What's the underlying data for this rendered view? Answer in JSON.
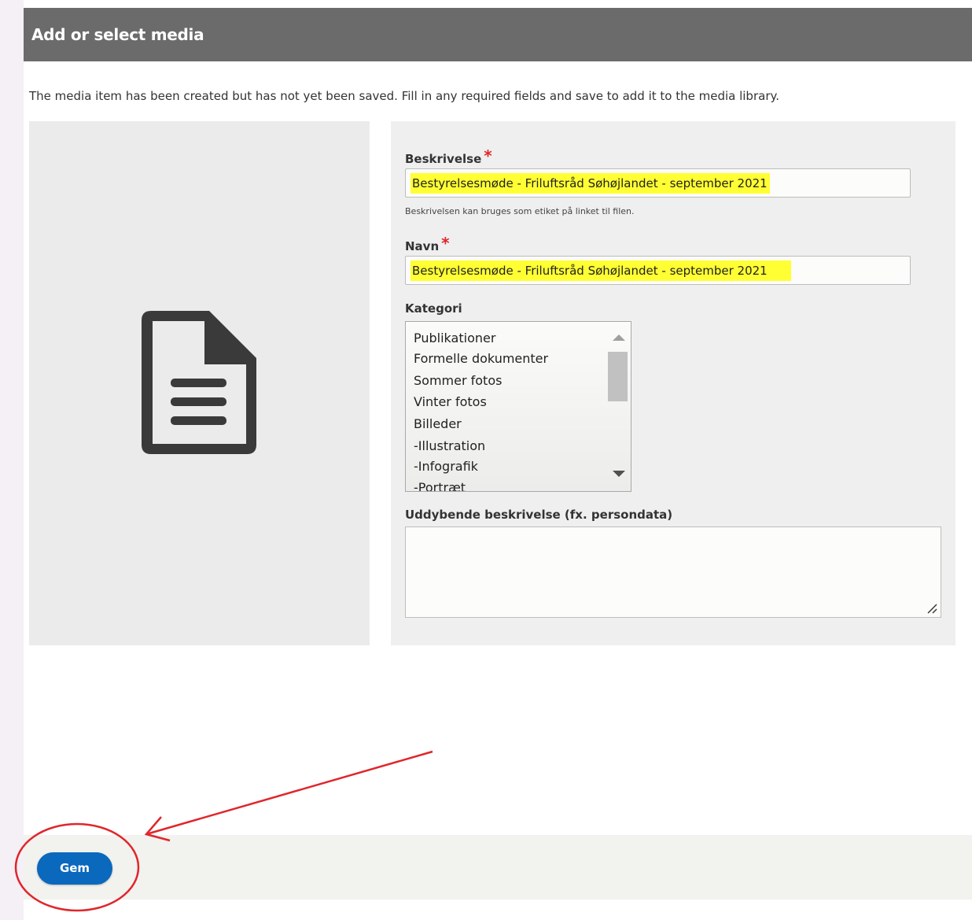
{
  "dialog": {
    "title": "Add or select media",
    "message": "The media item has been created but has not yet been saved. Fill in any required fields and save to add it to the media library."
  },
  "preview": {
    "icon": "document-icon"
  },
  "form": {
    "description": {
      "label": "Beskrivelse",
      "required_mark": "*",
      "value": "Bestyrelsesmøde - Friluftsråd Søhøjlandet - september 2021",
      "hint": "Beskrivelsen kan bruges som etiket på linket til filen."
    },
    "name": {
      "label": "Navn",
      "required_mark": "*",
      "value": "Bestyrelsesmøde - Friluftsråd Søhøjlandet - september 2021"
    },
    "category": {
      "label": "Kategori",
      "options": [
        "Publikationer",
        "Formelle dokumenter",
        "Sommer fotos",
        "Vinter fotos",
        "Billeder",
        "-Illustration",
        "-Infografik",
        "-Portræt"
      ]
    },
    "details": {
      "label": "Uddybende beskrivelse (fx. persondata)",
      "value": ""
    }
  },
  "footer": {
    "save_label": "Gem"
  },
  "colors": {
    "highlight": "#ffff33",
    "primary_button": "#0a68bd",
    "annotation": "#e0262b",
    "required": "#e0262b"
  }
}
